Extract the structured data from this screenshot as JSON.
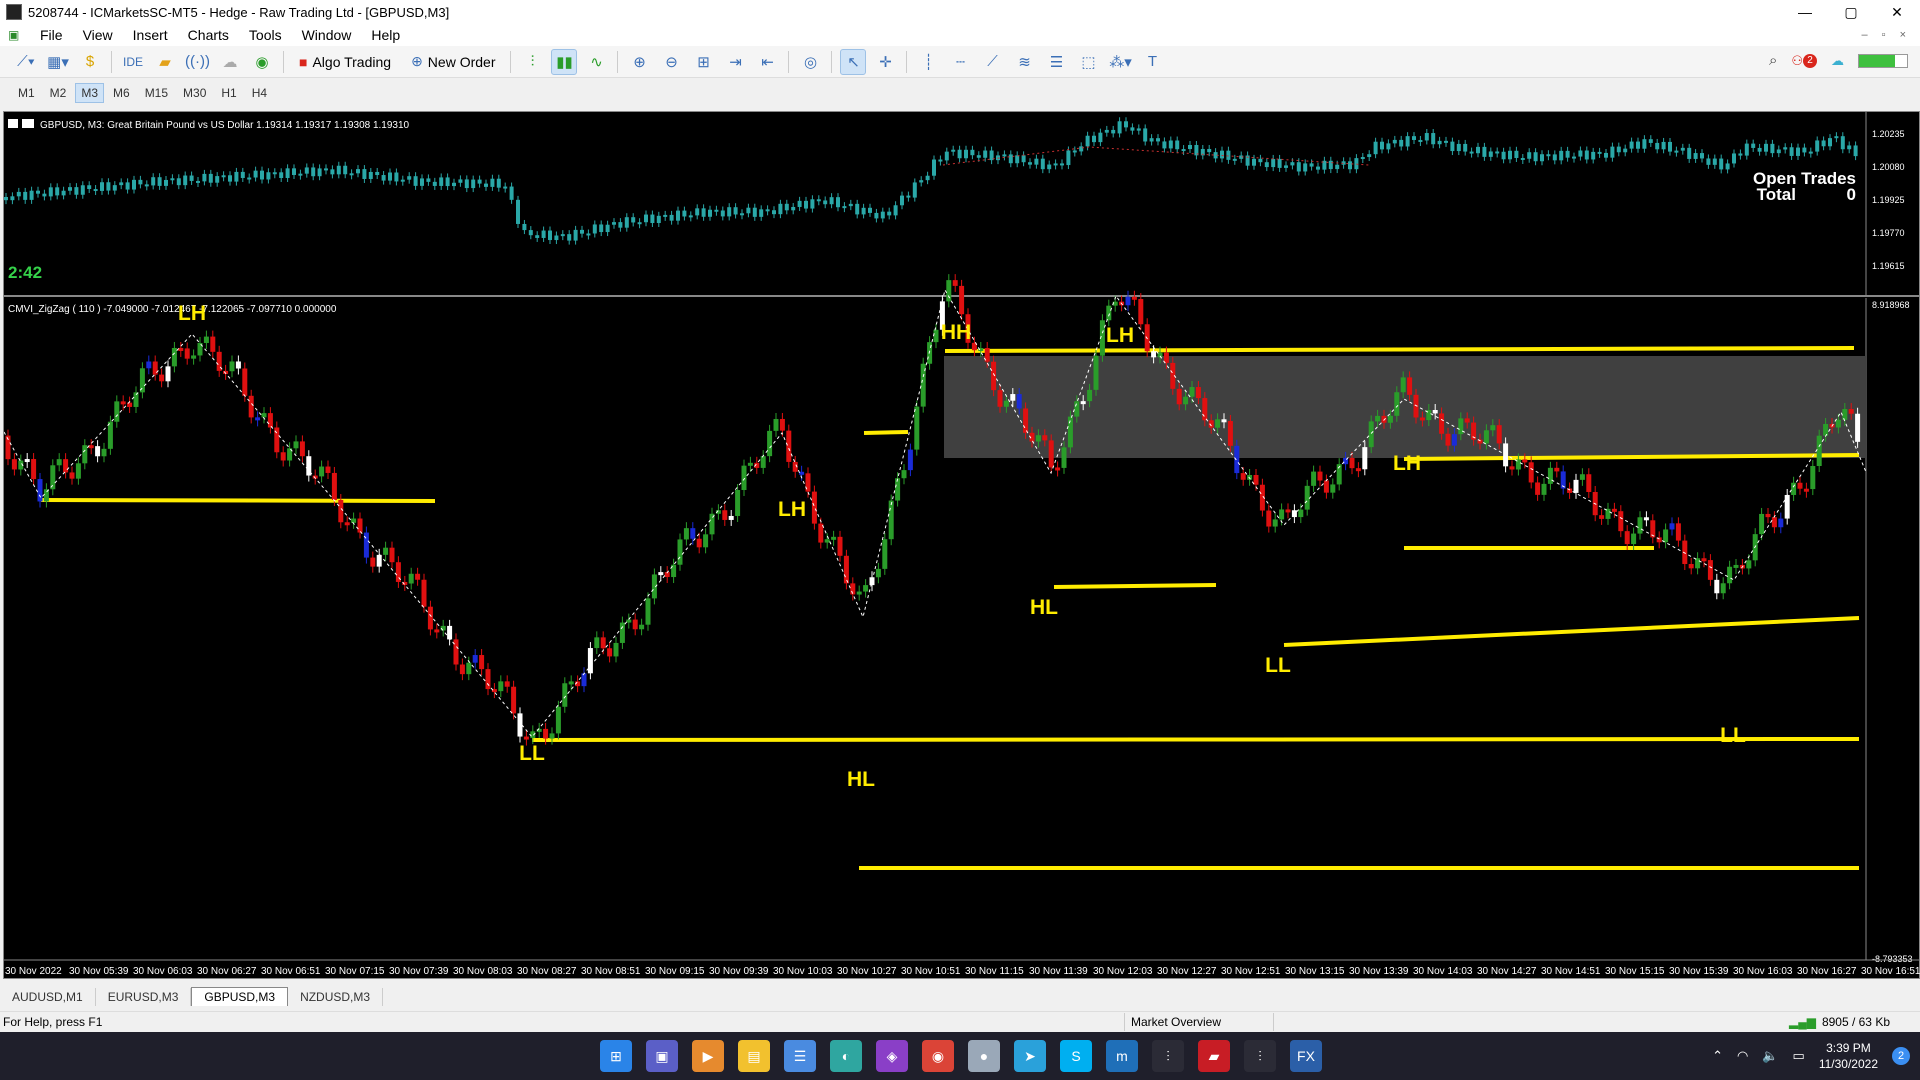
{
  "window": {
    "title": "5208744 - ICMarketsSC-MT5 - Hedge - Raw Trading Ltd - [GBPUSD,M3]",
    "controls": [
      "—",
      "▢",
      "✕"
    ],
    "mdi_controls": [
      "–",
      "▫",
      "×"
    ]
  },
  "menu": [
    "File",
    "View",
    "Insert",
    "Charts",
    "Tools",
    "Window",
    "Help"
  ],
  "toolbar": {
    "ide_label": "IDE",
    "algo_label": "Algo Trading",
    "new_order_label": "New Order",
    "notification_count": "2"
  },
  "timeframes": {
    "items": [
      "M1",
      "M2",
      "M3",
      "M6",
      "M15",
      "M30",
      "H1",
      "H4"
    ],
    "active": "M3"
  },
  "chart": {
    "header": "GBPUSD, M3:  Great Britain Pound vs US Dollar  1.19314 1.19317 1.19308 1.19310",
    "countdown": "2:42",
    "open_trades_label": "Open Trades",
    "total_label": "Total",
    "total_value": "0",
    "price_ticks": [
      "1.20235",
      "1.20080",
      "1.19925",
      "1.19770",
      "1.19615"
    ],
    "indicator_header": "CMVI_ZigZag ( 110 ) -7.049000 -7.012467 -7.122065 -7.097710 0.000000",
    "indicator_scale_top": "8.918968",
    "indicator_scale_bottom": "-8.793353",
    "time_labels": [
      "30 Nov 2022",
      "30 Nov 05:39",
      "30 Nov 06:03",
      "30 Nov 06:27",
      "30 Nov 06:51",
      "30 Nov 07:15",
      "30 Nov 07:39",
      "30 Nov 08:03",
      "30 Nov 08:27",
      "30 Nov 08:51",
      "30 Nov 09:15",
      "30 Nov 09:39",
      "30 Nov 10:03",
      "30 Nov 10:27",
      "30 Nov 10:51",
      "30 Nov 11:15",
      "30 Nov 11:39",
      "30 Nov 12:03",
      "30 Nov 12:27",
      "30 Nov 12:51",
      "30 Nov 13:15",
      "30 Nov 13:39",
      "30 Nov 14:03",
      "30 Nov 14:27",
      "30 Nov 14:51",
      "30 Nov 15:15",
      "30 Nov 15:39",
      "30 Nov 16:03",
      "30 Nov 16:27",
      "30 Nov 16:51"
    ],
    "swing_labels": [
      "LH",
      "LL",
      "LH",
      "HL",
      "HH",
      "HL",
      "LH",
      "LL",
      "LH",
      "LL"
    ],
    "colors": {
      "bull": "#2a9d2a",
      "bear": "#e01010",
      "neutral_up": "#ffffff",
      "neutral_down": "#1a2bd8",
      "price_candle": "#2aa8a8",
      "level_line": "#ffec00",
      "zone": "#404040"
    }
  },
  "tabs": {
    "items": [
      "AUDUSD,M1",
      "EURUSD,M3",
      "GBPUSD,M3",
      "NZDUSD,M3"
    ],
    "active": "GBPUSD,M3"
  },
  "status": {
    "help": "For Help, press F1",
    "market": "Market Overview",
    "traffic": "8905 / 63 Kb"
  },
  "taskbar": {
    "time": "3:39 PM",
    "date": "11/30/2022",
    "notifications": "2",
    "apps": [
      "windows-start",
      "teams",
      "media-player",
      "file-explorer",
      "notepad",
      "browser-edge",
      "game",
      "chrome",
      "orb",
      "telegram",
      "skype",
      "app-m",
      "metatrader",
      "app-red",
      "metatrader-2",
      "fx-app"
    ]
  }
}
